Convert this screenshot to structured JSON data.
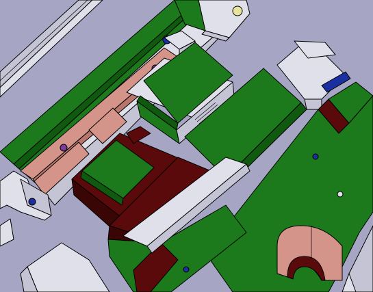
{
  "scene": {
    "kind": "cad-3d-assembly-view",
    "colors": {
      "background": "#a6a6c4",
      "green_part": "#1c7a1c",
      "green_dark": "#0f5a0f",
      "maroon_part": "#5a0a0a",
      "maroon_dark": "#3a0505",
      "salmon_part": "#d4948a",
      "salmon_dark": "#b8766c",
      "light_gray_part": "#e0e0ea",
      "mid_gray_part": "#c4c4d4",
      "blue_accent": "#1a2fa0",
      "yellow_bolt": "#e8e4a0",
      "purple_bolt": "#7a3d9a"
    }
  }
}
